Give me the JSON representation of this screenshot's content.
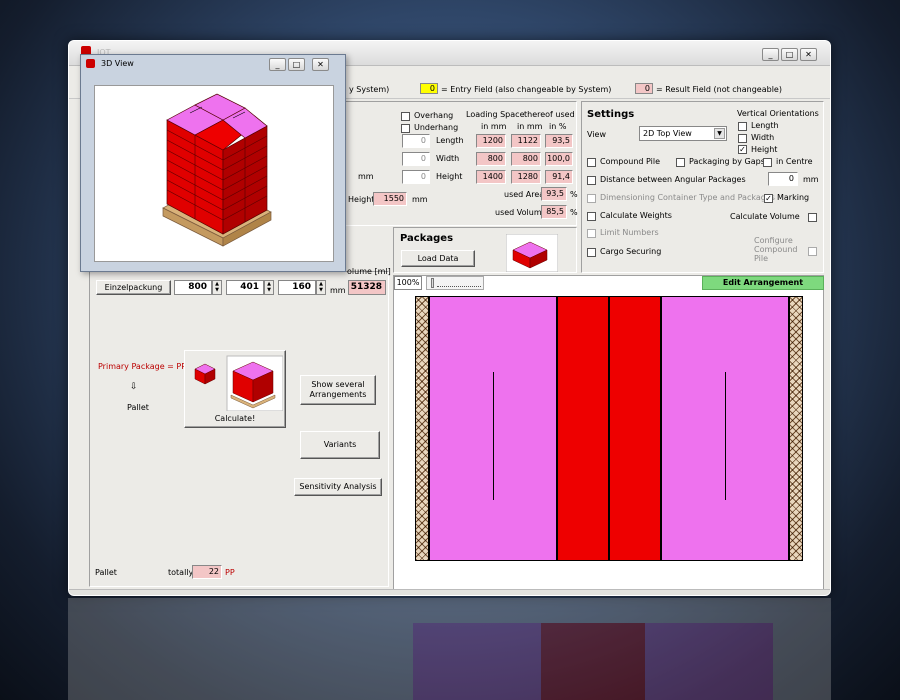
{
  "title_bar": {
    "faint_title": "IOT",
    "minimize": "_",
    "maximize": "□",
    "close": "✕"
  },
  "legend": {
    "system_suffix": "y System)",
    "entry_value": "0",
    "entry_text": "= Entry Field (also changeable by System)",
    "result_value": "0",
    "result_text": "= Result Field (not changeable)"
  },
  "loading": {
    "overhang": "Overhang",
    "underhang": "Underhang",
    "header_space": "Loading Space",
    "header_used": "thereof used",
    "unit_mm1": "in mm",
    "unit_mm2": "in mm",
    "unit_pct": "in %",
    "rows": [
      {
        "entry": "0",
        "label": "Length",
        "space": "1200",
        "used": "1122",
        "pct": "93,5"
      },
      {
        "entry": "0",
        "label": "Width",
        "space": "800",
        "used": "800",
        "pct": "100,0"
      },
      {
        "entry": "0",
        "label": "Height",
        "space": "1400",
        "used": "1280",
        "pct": "91,4"
      }
    ],
    "mm_label": "mm",
    "height_label": "Height",
    "height_value": "1550",
    "height_unit": "mm",
    "used_area_label": "used Area",
    "used_area_value": "93,5",
    "used_area_unit": "%",
    "used_volume_label": "used Volume",
    "used_volume_value": "85,5",
    "used_volume_unit": "%"
  },
  "settings": {
    "title": "Settings",
    "view_label": "View",
    "view_value": "2D Top View",
    "vertical_title": "Vertical Orientations",
    "vo_length": "Length",
    "vo_width": "Width",
    "vo_height": "Height",
    "compound_pile": "Compound Pile",
    "packaging_by_gaps": "Packaging by Gaps",
    "in_centre": "in Centre",
    "distance_angular": "Distance between Angular Packages",
    "distance_value": "0",
    "distance_unit": "mm",
    "dimensioning": "Dimensioning Container Type and Packages",
    "marking": "Marking",
    "calculate_weights": "Calculate Weights",
    "calculate_volume": "Calculate Volume",
    "limit_numbers": "Limit Numbers",
    "cargo_securing": "Cargo Securing",
    "configure_compound": "Configure Compound Pile",
    "check_mark": "✓"
  },
  "packages": {
    "title": "Packages",
    "load_data": "Load Data",
    "zoom": "100%",
    "edit_arrangement": "Edit Arrangement"
  },
  "left_panel": {
    "volume_header": "olume [ml]",
    "package_name": "Einzelpackung",
    "dim1": "800",
    "dim2": "401",
    "dim3": "160",
    "dim_unit": "mm",
    "volume_value": "51328",
    "primary_package": "Primary Package = PP",
    "arrow": "⇩",
    "pallet_flow": "Pallet",
    "calculate": "Calculate!",
    "show_several": "Show several Arrangements",
    "variants": "Variants",
    "sensitivity": "Sensitivity Analysis",
    "pallet_footer": "Pallet",
    "totally_label": "totally:",
    "totally_value": "22",
    "totally_unit": "PP"
  },
  "view3d": {
    "title": "3D View",
    "minimize": "_",
    "maximize": "□",
    "close": "✕"
  },
  "colors": {
    "pink_package": "#ee72ee",
    "red_package": "#ee0000",
    "green_header": "#7ed97e",
    "result_field": "#f3c6c6",
    "entry_field": "#ffff00"
  }
}
